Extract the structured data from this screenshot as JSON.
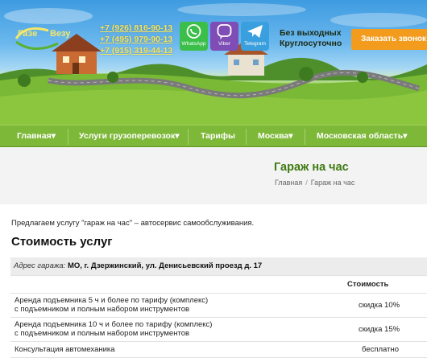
{
  "header": {
    "logo_part1": "Газе",
    "logo_part2": "Везу",
    "phones": [
      "+7 (926) 816-90-13",
      "+7 (495) 979-90-13",
      "+7 (915) 319-44-13"
    ],
    "messengers": [
      {
        "label": "WhatsApp",
        "icon": "whatsapp-icon",
        "color": "#3cbf4a"
      },
      {
        "label": "Viber",
        "icon": "viber-icon",
        "color": "#7e4db5"
      },
      {
        "label": "Telegram",
        "icon": "telegram-icon",
        "color": "#3a9fde"
      }
    ],
    "schedule_line1": "Без выходных",
    "schedule_line2": "Круглосуточно",
    "call_button": "Заказать звонок"
  },
  "nav": {
    "items": [
      {
        "label": "Главная",
        "dropdown": true
      },
      {
        "label": "Услуги грузоперевозок",
        "dropdown": true
      },
      {
        "label": "Тарифы",
        "dropdown": false
      },
      {
        "label": "Москва",
        "dropdown": true
      },
      {
        "label": "Московская область",
        "dropdown": true
      }
    ],
    "color": "#7eb839"
  },
  "page": {
    "title": "Гараж на час",
    "breadcrumb_home": "Главная",
    "breadcrumb_current": "Гараж на час"
  },
  "content": {
    "intro": "Предлагаем услугу \"гараж на час\" – автосервис самообслуживания.",
    "heading": "Стоимость услуг",
    "address_label": "Адрес гаража:",
    "address_value": "МО, г. Дзержинский, ул. Денисьевский проезд д. 17",
    "price_header": "Стоимость",
    "services": [
      {
        "line1": "Аренда подъемника 5 ч и более по тарифу (комплекс)",
        "line2": "с подъемником и полным набором инструментов",
        "price": "скидка 10%"
      },
      {
        "line1": "Аренда подъемника 10 ч и более по тарифу (комплекс)",
        "line2": "с подъемником и полным набором инструментов",
        "price": "скидка 15%"
      },
      {
        "line1": "Консультация автомеханика",
        "line2": "",
        "price": "бесплатно"
      }
    ]
  },
  "colors": {
    "accent_green": "#3f7a12",
    "call_orange": "#f29b1d",
    "phone_yellow": "#f7e45c"
  }
}
